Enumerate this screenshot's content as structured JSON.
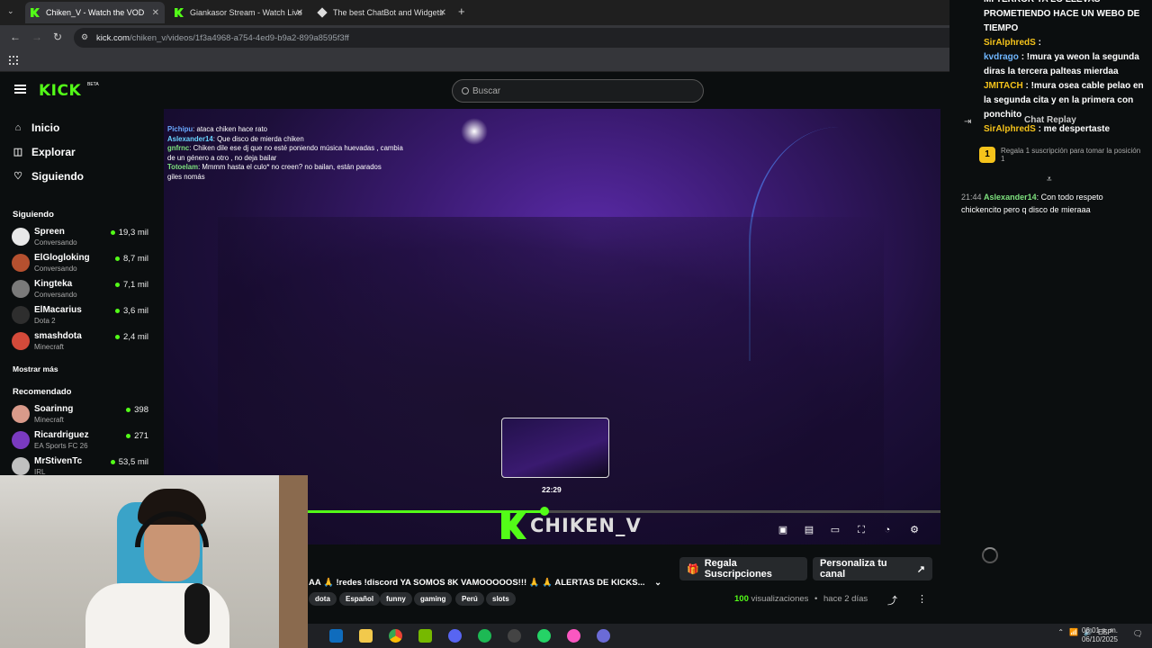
{
  "browser": {
    "tabs": [
      {
        "title": "Chiken_V - Watch the VOD"
      },
      {
        "title": "Giankasor Stream - Watch Live"
      },
      {
        "title": "The best ChatBot and Widgets"
      }
    ],
    "url_host": "kick.com",
    "url_path": "/chiken_v/videos/1f3a4968-a754-4ed9-b9a2-899a8595f3ff"
  },
  "header": {
    "logo": "KICK",
    "logo_badge": "BETA",
    "search_placeholder": "Buscar"
  },
  "nav": [
    {
      "label": "Inicio",
      "icon": "home-icon"
    },
    {
      "label": "Explorar",
      "icon": "compass-icon"
    },
    {
      "label": "Siguiendo",
      "icon": "heart-icon"
    }
  ],
  "following": {
    "title": "Siguiendo",
    "channels": [
      {
        "name": "Spreen",
        "category": "Conversando",
        "viewers": "19,3 mil",
        "color": "#e8e8e8"
      },
      {
        "name": "ElGlogloking",
        "category": "Conversando",
        "viewers": "8,7 mil",
        "color": "#b5502f"
      },
      {
        "name": "Kingteka",
        "category": "Conversando",
        "viewers": "7,1 mil",
        "color": "#7a7a7a"
      },
      {
        "name": "ElMacarius",
        "category": "Dota 2",
        "viewers": "3,6 mil",
        "color": "#2e2e2e"
      },
      {
        "name": "smashdota",
        "category": "Minecraft",
        "viewers": "2,4 mil",
        "color": "#d44a3a"
      }
    ],
    "show_more": "Mostrar más"
  },
  "recommended": {
    "title": "Recomendado",
    "channels": [
      {
        "name": "Soarinng",
        "category": "Minecraft",
        "viewers": "398",
        "color": "#d99a8a"
      },
      {
        "name": "Ricardriguez",
        "category": "EA Sports FC 26",
        "viewers": "271",
        "color": "#7a3ac0"
      },
      {
        "name": "MrStivenTc",
        "category": "IRL",
        "viewers": "53,5 mil",
        "color": "#c0c0c0"
      }
    ]
  },
  "video": {
    "overlay_chat": [
      {
        "user": "Pichipu",
        "text": "ataca chiken hace rato",
        "color": "#6aa9ff"
      },
      {
        "user": "Aslexander14",
        "text": "Que disco de mierda chiken",
        "color": "#6ad4ff"
      },
      {
        "user": "gnfrnc",
        "text": "Chiken dile ese dj que no esté poniendo música huevadas , cambia de un género a otro , no deja bailar",
        "color": "#7ee27e"
      },
      {
        "user": "Totoelam",
        "text": "Mmmm hasta el culo* no creen? no bailan, están parados",
        "color": "#7ee27e"
      },
      {
        "user": "",
        "text": "giles nomás",
        "color": "#ffffff"
      }
    ],
    "preview_time": "22:29",
    "progress": 0.374,
    "wordmark": "CHIKEN_V",
    "title": "AA 🙏 !redes !discord YA SOMOS 8K VAMOOOOOS!!! 🙏 🙏 ALERTAS DE KICKS...",
    "tags": [
      "dota",
      "Español",
      "funny",
      "gaming",
      "Perú",
      "slots"
    ],
    "views_count": "100",
    "views_label": "visualizaciones",
    "age": "hace 2 días",
    "gift_button": "Regala Suscripciones",
    "customize_button": "Personaliza tu canal"
  },
  "chat": {
    "top_lines": [
      {
        "user": "",
        "text": "MI TERROR YA LO LLEVAS PROMETIENDO HACE UN WEBO DE TIEMPO",
        "cls": ""
      },
      {
        "user": "SirAlphredS",
        "text": ":",
        "cls": "ul"
      },
      {
        "user": "kvdrago",
        "text": ": !mura ya weon la segunda diras la tercera palteas mierdaa",
        "cls": "ub"
      },
      {
        "user": "JMITACH",
        "text": ": !mura osea cable pelao en la segunda cita y en la primera con ponchito",
        "cls": "ul"
      },
      {
        "user": "SirAlphredS",
        "text": ": me despertaste",
        "cls": "ul"
      }
    ],
    "replay_label": "Chat Replay",
    "gift_rank": "1",
    "gift_text": "Regala 1 suscripción para tomar la posición 1",
    "messages": [
      {
        "time": "21:44",
        "user": "Aslexander14",
        "text": "Con todo respeto chickencito pero q disco de mieraaa"
      }
    ]
  },
  "taskbar": {
    "lang": "ESP",
    "time": "06:01 p. m.",
    "date": "06/10/2025",
    "notifications": "2"
  }
}
